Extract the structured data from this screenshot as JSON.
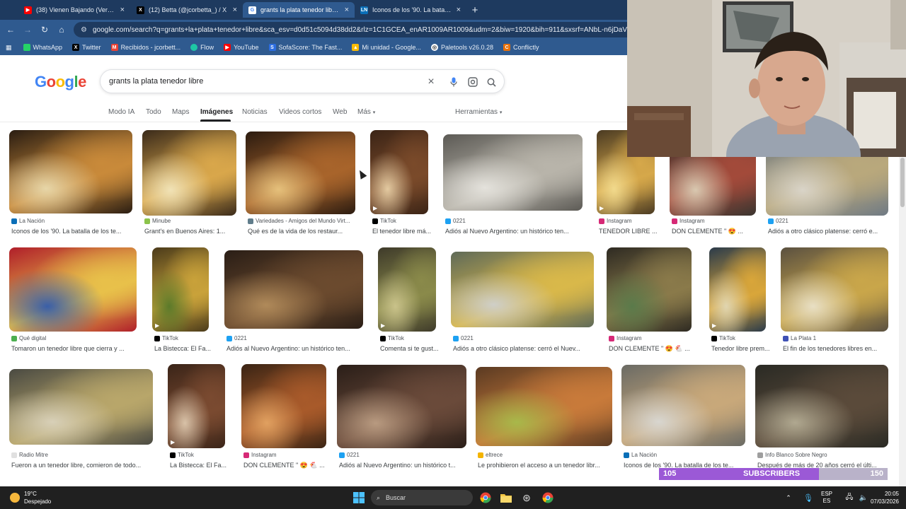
{
  "tabs": [
    {
      "title": "(38) Vienen Bajando (Versión 2)",
      "icon": "youtube-icon",
      "icon_color": "#ff0000"
    },
    {
      "title": "(12) Betta (@jcorbetta_) / X",
      "icon": "x-icon",
      "icon_color": "#000000"
    },
    {
      "title": "grants la plata tenedor libre - B",
      "icon": "google-icon",
      "icon_color": "#ffffff"
    },
    {
      "title": "Iconos de los '90. La batalla de",
      "icon": "la-nacion-icon",
      "icon_color": "#0a6fb8"
    }
  ],
  "address_bar": {
    "url": "google.com/search?q=grants+la+plata+tenedor+libre&sca_esv=d0d51c5094d38dd2&rlz=1C1GCEA_enAR1009AR1009&udm=2&biw=1920&bih=911&sxsrf=ANbL-n6jDaVgwlSgLAVP"
  },
  "bookmarks": [
    {
      "label": "WhatsApp",
      "icon": "whatsapp-icon",
      "color": "#25d366"
    },
    {
      "label": "Twitter",
      "icon": "x-icon",
      "color": "#000000"
    },
    {
      "label": "Recibidos - jcorbett...",
      "icon": "gmail-icon",
      "color": "#ea4335"
    },
    {
      "label": "Flow",
      "icon": "flow-icon",
      "color": "#1ec8a5"
    },
    {
      "label": "YouTube",
      "icon": "youtube-icon",
      "color": "#ff0000"
    },
    {
      "label": "SofaScore: The Fast...",
      "icon": "sofascore-icon",
      "color": "#2c6de0"
    },
    {
      "label": "Mi unidad - Google...",
      "icon": "drive-icon",
      "color": "#fbbc04"
    },
    {
      "label": "Paletools v26.0.28",
      "icon": "paletools-icon",
      "color": "#ffffff"
    },
    {
      "label": "Conflictly",
      "icon": "conflictly-icon",
      "color": "#e8710a"
    }
  ],
  "google": {
    "logo_letters": [
      "G",
      "o",
      "o",
      "g",
      "l",
      "e"
    ],
    "logo_colors": [
      "#4285f4",
      "#ea4335",
      "#fbbc05",
      "#4285f4",
      "#34a853",
      "#ea4335"
    ],
    "query": "grants la plata tenedor libre",
    "filters": [
      "Modo IA",
      "Todo",
      "Maps",
      "Imágenes",
      "Noticias",
      "Videos cortos",
      "Web",
      "Más"
    ],
    "active_filter": "Imágenes",
    "tools_label": "Herramientas"
  },
  "results": [
    {
      "source": "La Nación",
      "title": "Iconos de los '90. La batalla de los te...",
      "src_color": "#0a6fb8",
      "palette": [
        "#2a1d12",
        "#c98a3a",
        "#e7d6a8"
      ],
      "video": false
    },
    {
      "source": "Minube",
      "title": "Grant's en Buenos Aires: 1...",
      "src_color": "#8bc34a",
      "palette": [
        "#3a2a1a",
        "#d9a74b",
        "#f0e2b6"
      ],
      "video": false
    },
    {
      "source": "Variedades - Amigos del Mundo Virt...",
      "title": "Qué es de la vida de los restaur...",
      "src_color": "#607d8b",
      "palette": [
        "#2b1b10",
        "#a8642b",
        "#e5c07b"
      ],
      "video": false
    },
    {
      "source": "TikTok",
      "title": "El tenedor libre má...",
      "src_color": "#000000",
      "palette": [
        "#3b2416",
        "#7a4a2a",
        "#e3c9a0"
      ],
      "video": true
    },
    {
      "source": "0221",
      "title": "Adiós al Nuevo Argentino: un histórico ten...",
      "src_color": "#1da1f2",
      "palette": [
        "#5c5a55",
        "#b8b4aa",
        "#e4e2dc"
      ],
      "video": false
    },
    {
      "source": "Instagram",
      "title": "TENEDOR LIBRE ...",
      "src_color": "#d62976",
      "palette": [
        "#4a3a22",
        "#d6a84a",
        "#f1d98c"
      ],
      "video": true
    },
    {
      "source": "Instagram",
      "title": "DON CLEMENTE \" 😍 ...",
      "src_color": "#d62976",
      "palette": [
        "#3a3530",
        "#a34a3a",
        "#d8c8b0"
      ],
      "video": false
    },
    {
      "source": "0221",
      "title": "Adiós a otro clásico platense: cerró e...",
      "src_color": "#1da1f2",
      "palette": [
        "#6f7a84",
        "#b9a87c",
        "#d9d4c8"
      ],
      "video": false
    },
    {
      "source": "Qué digital",
      "title": "Tomaron un tenedor libre que cierra y ...",
      "src_color": "#4caf50",
      "palette": [
        "#b01e2a",
        "#e8c14a",
        "#3a5fa8"
      ],
      "video": false
    },
    {
      "source": "TikTok",
      "title": "La Bistecca: El Fa...",
      "src_color": "#000000",
      "palette": [
        "#4a3a1a",
        "#c9a23a",
        "#5b7a2a"
      ],
      "video": true
    },
    {
      "source": "0221",
      "title": "Adiós al Nuevo Argentino: un histórico ten...",
      "src_color": "#1da1f2",
      "palette": [
        "#2a1e16",
        "#6b4a2e",
        "#b08a5a"
      ],
      "video": false
    },
    {
      "source": "TikTok",
      "title": "Comenta si te gust...",
      "src_color": "#000000",
      "palette": [
        "#3e3a2a",
        "#8a8a4a",
        "#c9c28a"
      ],
      "video": true
    },
    {
      "source": "0221",
      "title": "Adiós a otro clásico platense: cerró el Nuev...",
      "src_color": "#1da1f2",
      "palette": [
        "#5f6a58",
        "#d9b84a",
        "#cfcfc8"
      ],
      "video": false
    },
    {
      "source": "Instagram",
      "title": "DON CLEMENTE \" 😍 🐔 ...",
      "src_color": "#d62976",
      "palette": [
        "#2e2a22",
        "#8a7a4a",
        "#5a7a4a"
      ],
      "video": false
    },
    {
      "source": "TikTok",
      "title": "Tenedor libre prem...",
      "src_color": "#000000",
      "palette": [
        "#2a3a4a",
        "#d9a63a",
        "#e0d5b0"
      ],
      "video": true
    },
    {
      "source": "La Plata 1",
      "title": "El fin de los tenedores libres en...",
      "src_color": "#3f51b5",
      "palette": [
        "#5a5040",
        "#c9a64a",
        "#e8dfc4"
      ],
      "video": false
    },
    {
      "source": "Radio Mitre",
      "title": "Fueron a un tenedor libre, comieron de todo...",
      "src_color": "#e0e0e0",
      "palette": [
        "#4a4a42",
        "#b8a66a",
        "#d8d0b8"
      ],
      "video": false
    },
    {
      "source": "TikTok",
      "title": "La Bistecca: El Fa...",
      "src_color": "#000000",
      "palette": [
        "#3a2418",
        "#7a4a30",
        "#d8c2a8"
      ],
      "video": true
    },
    {
      "source": "Instagram",
      "title": "DON CLEMENTE \" 😍 🐔 ...",
      "src_color": "#d62976",
      "palette": [
        "#3a2414",
        "#a85a2a",
        "#e0a060"
      ],
      "video": false
    },
    {
      "source": "0221",
      "title": "Adiós al Nuevo Argentino: un histórico t...",
      "src_color": "#1da1f2",
      "palette": [
        "#2a1e18",
        "#6a4a3a",
        "#b89a80"
      ],
      "video": false
    },
    {
      "source": "eltrece",
      "title": "Le prohibieron el acceso a un tenedor libr...",
      "src_color": "#f4b400",
      "palette": [
        "#5a3a22",
        "#c87a3a",
        "#a8b84a"
      ],
      "video": false
    },
    {
      "source": "La Nación",
      "title": "Iconos de los '90. La batalla de los te...",
      "src_color": "#0a6fb8",
      "palette": [
        "#6a6a64",
        "#c8a87a",
        "#d8d6d0"
      ],
      "video": false
    },
    {
      "source": "Info Blanco Sobre Negro",
      "title": "Después de más de 20 años cerró el últi...",
      "src_color": "#9e9e9e",
      "palette": [
        "#2a2a24",
        "#5a4a3a",
        "#b0a890"
      ],
      "video": false
    }
  ],
  "subscribers": {
    "current": "105",
    "label": "SUBSCRIBERS",
    "goal": "150",
    "progress": 0.7
  },
  "taskbar": {
    "weather_temp": "19°C",
    "weather_desc": "Despejado",
    "search_placeholder": "Buscar",
    "lang_top": "ESP",
    "lang_bottom": "ES",
    "time": "20:05",
    "date": "07/03/2026"
  }
}
